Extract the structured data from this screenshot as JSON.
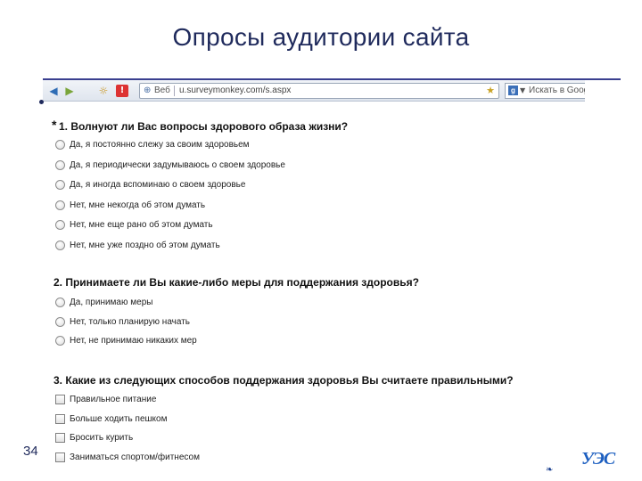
{
  "slide": {
    "title": "Опросы аудитории сайта",
    "page_number": "34",
    "logo_text": "УЭС"
  },
  "browser": {
    "url_label": "Веб",
    "url": "u.surveymonkey.com/s.aspx",
    "search_placeholder": "Искать в Goog",
    "search_engine_letter": "g"
  },
  "survey": {
    "q1": {
      "required_mark": "*",
      "title": "1. Волнуют ли Вас вопросы здорового образа жизни?",
      "options": [
        "Да, я постоянно слежу за своим здоровьем",
        "Да, я периодически задумываюсь о своем здоровье",
        "Да, я иногда вспоминаю о своем здоровье",
        "Нет, мне некогда об этом думать",
        "Нет, мне еще рано об этом думать",
        "Нет, мне уже поздно об этом думать"
      ]
    },
    "q2": {
      "title": "2. Принимаете ли Вы какие-либо меры для поддержания здоровья?",
      "options": [
        "Да, принимаю меры",
        "Нет, только планирую начать",
        "Нет, не принимаю никаких мер"
      ]
    },
    "q3": {
      "title": "3. Какие из следующих способов поддержания здоровья Вы считаете правильными?",
      "options": [
        "Правильное питание",
        "Больше ходить пешком",
        "Бросить курить",
        "Заниматься спортом/фитнесом"
      ]
    }
  }
}
